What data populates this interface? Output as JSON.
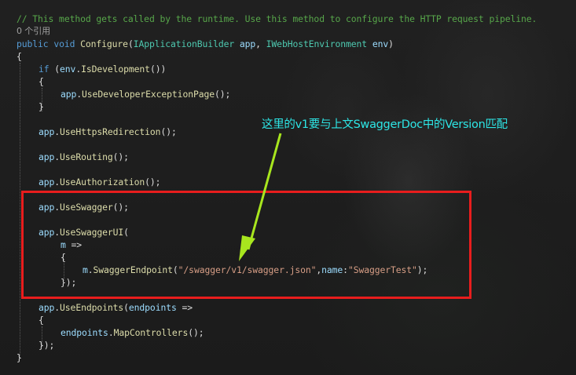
{
  "code": {
    "comment": "// This method gets called by the runtime. Use this method to configure the HTTP request pipeline.",
    "refcount": "0 个引用",
    "sig_public": "public",
    "sig_void": "void",
    "sig_method": "Configure",
    "sig_type1": "IApplicationBuilder",
    "sig_arg1": "app",
    "sig_type2": "IWebHostEnvironment",
    "sig_arg2": "env",
    "if_kw": "if",
    "env": "env",
    "is_dev": "IsDevelopment",
    "app": "app",
    "use_dev_exc": "UseDeveloperExceptionPage",
    "use_https": "UseHttpsRedirection",
    "use_routing": "UseRouting",
    "use_auth": "UseAuthorization",
    "use_swagger": "UseSwagger",
    "use_swagger_ui": "UseSwaggerUI",
    "m": "m",
    "swagger_endpoint": "SwaggerEndpoint",
    "endpoint_url": "\"/swagger/v1/swagger.json\"",
    "name_param": "name",
    "endpoint_name": "\"SwaggerTest\"",
    "use_endpoints": "UseEndpoints",
    "endpoints": "endpoints",
    "map_controllers": "MapControllers"
  },
  "annotation": {
    "text": "这里的v1要与上文SwaggerDoc中的Version匹配",
    "text_color": "#2de6e6",
    "arrow_color": "#a8e61e",
    "box_color": "#e81d1d"
  }
}
